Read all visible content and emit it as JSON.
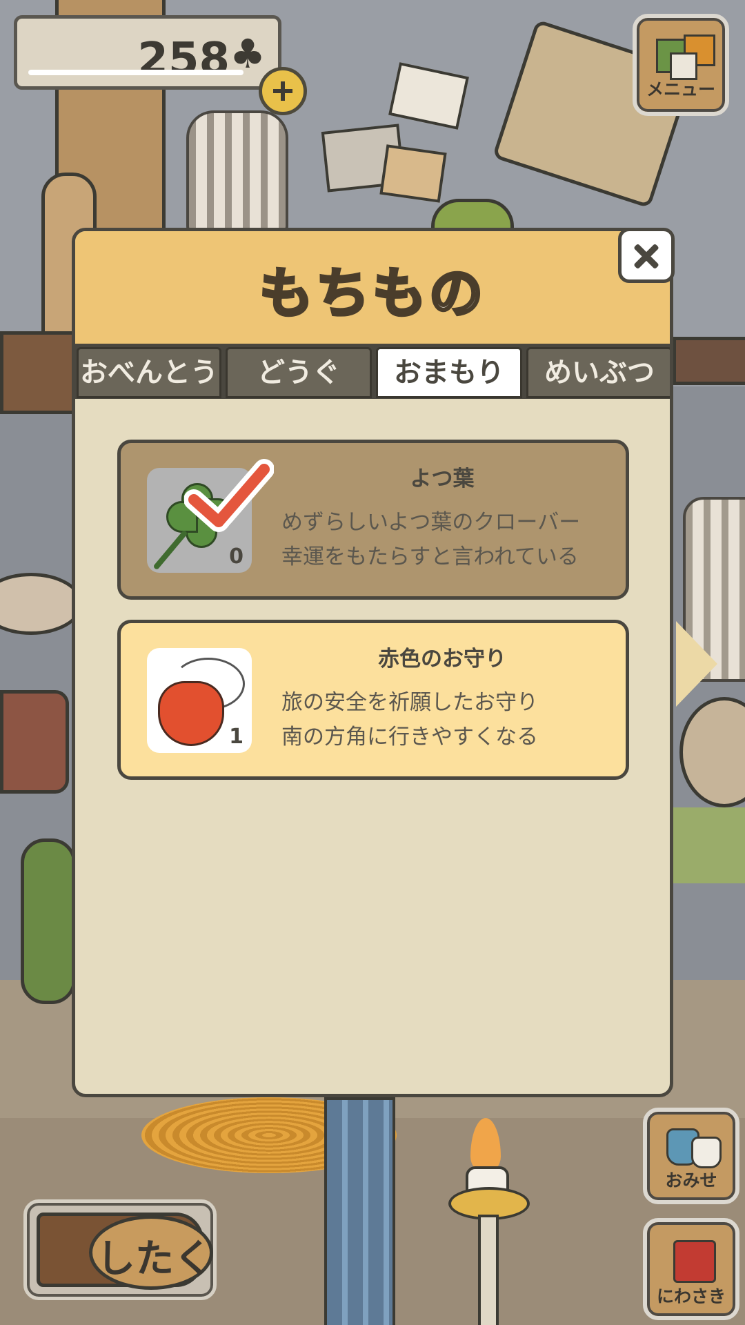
{
  "hud": {
    "clover_count": "258",
    "clover_icon": "♣",
    "add_clover_icon": "plus-icon",
    "menu_label": "メニュー",
    "shop_label": "おみせ",
    "garden_label": "にわさき",
    "prepare_label": "したく"
  },
  "inventory": {
    "title": "もちもの",
    "close_icon": "close-icon",
    "tabs": [
      {
        "label": "おべんとう",
        "active": false
      },
      {
        "label": "どうぐ",
        "active": false
      },
      {
        "label": "おまもり",
        "active": true
      },
      {
        "label": "めいぶつ",
        "active": false
      }
    ],
    "items": [
      {
        "name": "よつ葉",
        "quantity": "0",
        "selected": true,
        "icon": "four-leaf-clover-icon",
        "description": [
          "めずらしいよつ葉のクローバー",
          "幸運をもたらすと言われている"
        ]
      },
      {
        "name": "赤色のお守り",
        "quantity": "1",
        "selected": false,
        "icon": "red-amulet-icon",
        "description": [
          "旅の安全を祈願したお守り",
          "南の方角に行きやすくなる"
        ]
      }
    ]
  },
  "colors": {
    "header": "#eec575",
    "panel": "#e5dcc0",
    "selected_card": "#ae956e",
    "card": "#fce09d",
    "tab_active": "#ffffff",
    "tab_inactive": "#6b6659",
    "check": "#e4563d"
  }
}
